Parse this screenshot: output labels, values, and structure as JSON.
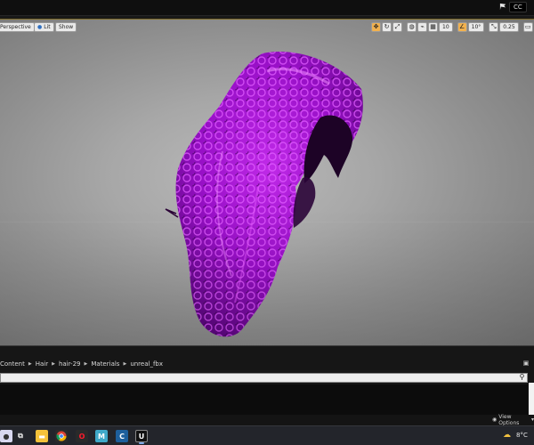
{
  "topbar": {
    "badge_label": "CC"
  },
  "viewport": {
    "perspective_label": "Perspective",
    "lit_label": "Lit",
    "show_label": "Show",
    "grid_snap_value": "10",
    "rotation_snap_value": "10°",
    "scale_snap_value": "0.25",
    "camera_speed_value": "2"
  },
  "content_browser": {
    "breadcrumbs": [
      "Content",
      "Hair",
      "hair-29",
      "Materials",
      "unreal_fbx"
    ],
    "search_placeholder": "",
    "view_options_label": "View Options"
  },
  "taskbar": {
    "temperature": "8°C"
  },
  "colors": {
    "hair_primary": "#a313d1",
    "hair_highlight": "#e85cff",
    "hair_shadow": "#3a0550",
    "accent_orange": "#f1b14f"
  }
}
